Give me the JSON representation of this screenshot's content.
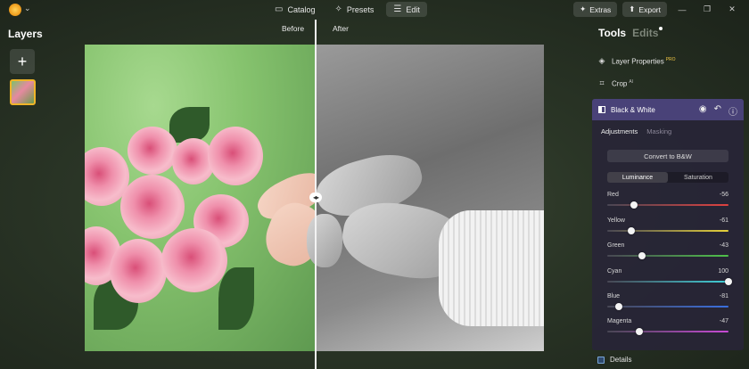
{
  "topbar": {
    "tabs": [
      {
        "label": "Catalog",
        "icon": "folder-icon",
        "active": false
      },
      {
        "label": "Presets",
        "icon": "magic-wand-icon",
        "active": false
      },
      {
        "label": "Edit",
        "icon": "sliders-icon",
        "active": true
      }
    ],
    "extras_label": "Extras",
    "export_label": "Export"
  },
  "layers": {
    "title": "Layers",
    "add_icon": "plus-icon"
  },
  "canvas": {
    "before_label": "Before",
    "after_label": "After"
  },
  "tools": {
    "tab_active": "Tools",
    "tab_inactive": "Edits",
    "layer_properties": {
      "label": "Layer Properties",
      "badge": "PRO"
    },
    "crop": {
      "label": "Crop",
      "badge": "AI"
    }
  },
  "bw_panel": {
    "title": "Black & White",
    "sub_tabs": [
      "Adjustments",
      "Masking"
    ],
    "convert_label": "Convert to B&W",
    "segments": [
      "Luminance",
      "Saturation"
    ],
    "sliders": [
      {
        "name": "Red",
        "value": "-56",
        "level": -56,
        "color": "#e0413f"
      },
      {
        "name": "Yellow",
        "value": "-61",
        "level": -61,
        "color": "#e6d13a"
      },
      {
        "name": "Green",
        "value": "-43",
        "level": -43,
        "color": "#4fc24a"
      },
      {
        "name": "Cyan",
        "value": "100",
        "level": 100,
        "color": "#3fd0d8"
      },
      {
        "name": "Blue",
        "value": "-81",
        "level": -81,
        "color": "#3a6fe0"
      },
      {
        "name": "Magenta",
        "value": "-47",
        "level": -47,
        "color": "#c94ad6"
      }
    ]
  },
  "details": {
    "label": "Details"
  },
  "colors": {
    "accent": "#f0b429",
    "panel_header": "#4e4680"
  }
}
